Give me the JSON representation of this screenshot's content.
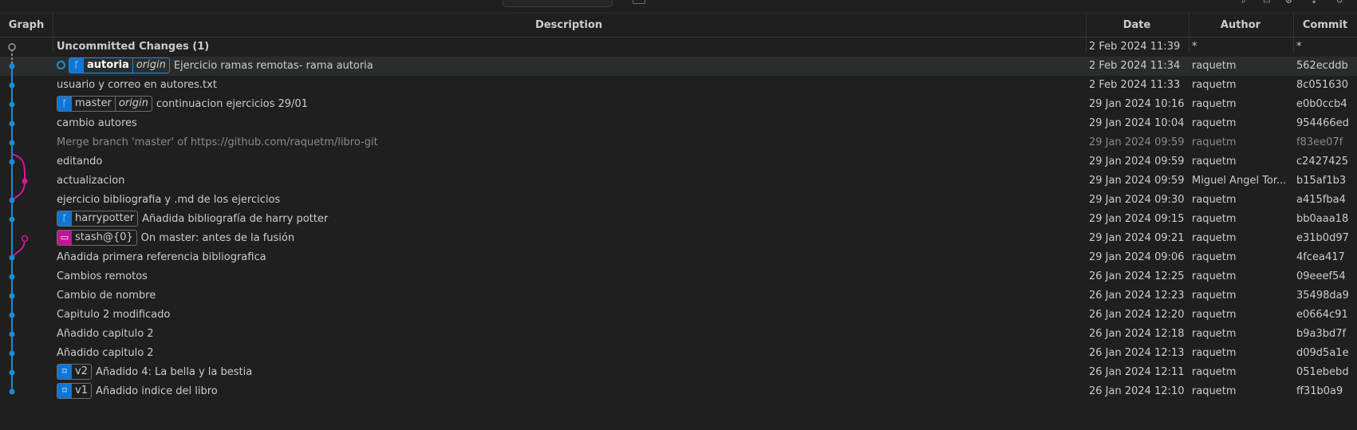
{
  "toolbar": {
    "icons": [
      "search-icon",
      "window-icon",
      "gear-icon",
      "download-icon",
      "history-icon"
    ]
  },
  "columns": {
    "graph": "Graph",
    "description": "Description",
    "date": "Date",
    "author": "Author",
    "commit": "Commit"
  },
  "colors": {
    "main_lane": "#1f8ad2",
    "side_lane": "#d1189e",
    "ref_blue": "#1076d4",
    "stash_pink": "#c4149a"
  },
  "rows": [
    {
      "description": "Uncommitted Changes (1)",
      "date": "2 Feb 2024 11:39",
      "author": "*",
      "commit": "*"
    },
    {
      "ref": {
        "name": "autoria",
        "origin": "origin",
        "icon": "branch-icon"
      },
      "description": "Ejercicio ramas remotas- rama autoria",
      "date": "2 Feb 2024 11:34",
      "author": "raquetm",
      "commit": "562ecddb"
    },
    {
      "description": "usuario y correo en autores.txt",
      "date": "2 Feb 2024 11:33",
      "author": "raquetm",
      "commit": "8c051630"
    },
    {
      "ref": {
        "name": "master",
        "origin": "origin",
        "icon": "branch-icon"
      },
      "description": "continuacion ejercicios 29/01",
      "date": "29 Jan 2024 10:16",
      "author": "raquetm",
      "commit": "e0b0ccb4"
    },
    {
      "description": "cambio autores",
      "date": "29 Jan 2024 10:04",
      "author": "raquetm",
      "commit": "954466ed"
    },
    {
      "description": "Merge branch 'master' of https://github.com/raquetm/libro-git",
      "date": "29 Jan 2024 09:59",
      "author": "raquetm",
      "commit": "f83ee07f"
    },
    {
      "description": "editando",
      "date": "29 Jan 2024 09:59",
      "author": "raquetm",
      "commit": "c2427425"
    },
    {
      "description": "actualizacion",
      "date": "29 Jan 2024 09:59",
      "author": "Miguel Angel Tor...",
      "commit": "b15af1b3"
    },
    {
      "description": "ejercicio bibliografia y .md de los ejercicios",
      "date": "29 Jan 2024 09:30",
      "author": "raquetm",
      "commit": "a415fba4"
    },
    {
      "ref": {
        "name": "harrypotter",
        "icon": "branch-icon"
      },
      "description": "Añadida bibliografía de harry potter",
      "date": "29 Jan 2024 09:15",
      "author": "raquetm",
      "commit": "bb0aaa18"
    },
    {
      "ref": {
        "name": "stash@{0}",
        "icon": "stash-icon"
      },
      "description": "On master: antes de la fusión",
      "date": "29 Jan 2024 09:21",
      "author": "raquetm",
      "commit": "e31b0d97"
    },
    {
      "description": "Añadida primera referencia bibliografica",
      "date": "29 Jan 2024 09:06",
      "author": "raquetm",
      "commit": "4fcea417"
    },
    {
      "description": "Cambios remotos",
      "date": "26 Jan 2024 12:25",
      "author": "raquetm",
      "commit": "09eeef54"
    },
    {
      "description": "Cambio de nombre",
      "date": "26 Jan 2024 12:23",
      "author": "raquetm",
      "commit": "35498da9"
    },
    {
      "description": "Capitulo 2 modificado",
      "date": "26 Jan 2024 12:20",
      "author": "raquetm",
      "commit": "e0664c91"
    },
    {
      "description": "Añadido capitulo 2",
      "date": "26 Jan 2024 12:18",
      "author": "raquetm",
      "commit": "b9a3bd7f"
    },
    {
      "description": "Añadido capitulo 2",
      "date": "26 Jan 2024 12:13",
      "author": "raquetm",
      "commit": "d09d5a1e"
    },
    {
      "ref": {
        "name": "v2",
        "icon": "tag-icon"
      },
      "description": "Añadido 4: La bella y la bestia",
      "date": "26 Jan 2024 12:11",
      "author": "raquetm",
      "commit": "051ebebd"
    },
    {
      "ref": {
        "name": "v1",
        "icon": "tag-icon"
      },
      "description": "Añadido indice del libro",
      "date": "26 Jan 2024 12:10",
      "author": "raquetm",
      "commit": "ff31b0a9"
    }
  ]
}
